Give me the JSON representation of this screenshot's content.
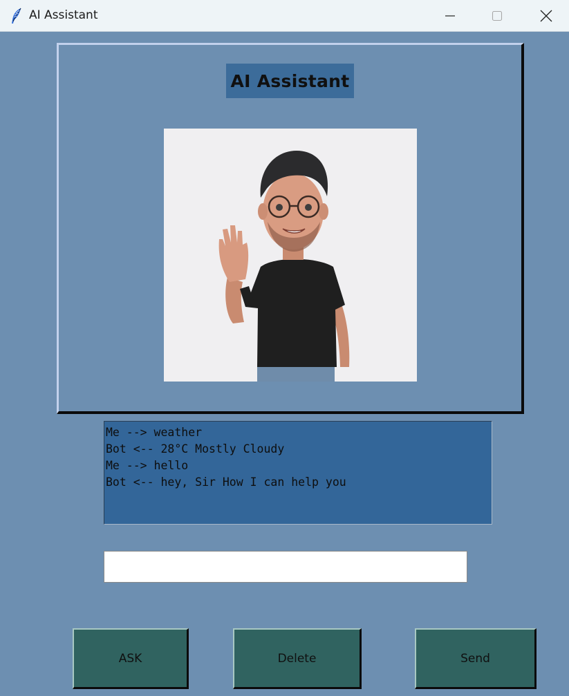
{
  "window": {
    "title": "AI Assistant",
    "icon": "feather-icon",
    "controls": [
      "minimize-icon",
      "maximize-icon",
      "close-icon"
    ]
  },
  "header": {
    "title": "AI Assistant"
  },
  "avatar": {
    "description_icon": "waving-avatar-image"
  },
  "chat": {
    "lines": [
      "Me --> weather",
      "Bot <-- 28°C Mostly Cloudy",
      "Me --> hello",
      "Bot <-- hey, Sir How I can help you"
    ]
  },
  "input": {
    "value": "",
    "placeholder": ""
  },
  "buttons": {
    "ask": "ASK",
    "delete": "Delete",
    "send": "Send"
  },
  "colors": {
    "background": "#6d8fb1",
    "heading_bg": "#3c6c9a",
    "chat_bg": "#336699",
    "button_bg": "#306360"
  }
}
